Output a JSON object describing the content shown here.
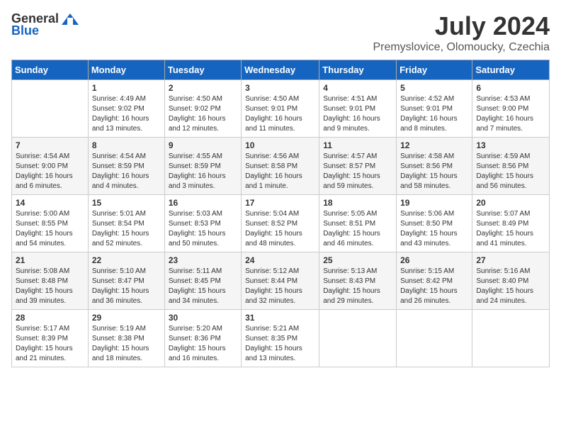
{
  "header": {
    "logo_general": "General",
    "logo_blue": "Blue",
    "title": "July 2024",
    "subtitle": "Premyslovice, Olomoucky, Czechia"
  },
  "days_of_week": [
    "Sunday",
    "Monday",
    "Tuesday",
    "Wednesday",
    "Thursday",
    "Friday",
    "Saturday"
  ],
  "weeks": [
    [
      {
        "day": "",
        "info": ""
      },
      {
        "day": "1",
        "info": "Sunrise: 4:49 AM\nSunset: 9:02 PM\nDaylight: 16 hours\nand 13 minutes."
      },
      {
        "day": "2",
        "info": "Sunrise: 4:50 AM\nSunset: 9:02 PM\nDaylight: 16 hours\nand 12 minutes."
      },
      {
        "day": "3",
        "info": "Sunrise: 4:50 AM\nSunset: 9:01 PM\nDaylight: 16 hours\nand 11 minutes."
      },
      {
        "day": "4",
        "info": "Sunrise: 4:51 AM\nSunset: 9:01 PM\nDaylight: 16 hours\nand 9 minutes."
      },
      {
        "day": "5",
        "info": "Sunrise: 4:52 AM\nSunset: 9:01 PM\nDaylight: 16 hours\nand 8 minutes."
      },
      {
        "day": "6",
        "info": "Sunrise: 4:53 AM\nSunset: 9:00 PM\nDaylight: 16 hours\nand 7 minutes."
      }
    ],
    [
      {
        "day": "7",
        "info": "Sunrise: 4:54 AM\nSunset: 9:00 PM\nDaylight: 16 hours\nand 6 minutes."
      },
      {
        "day": "8",
        "info": "Sunrise: 4:54 AM\nSunset: 8:59 PM\nDaylight: 16 hours\nand 4 minutes."
      },
      {
        "day": "9",
        "info": "Sunrise: 4:55 AM\nSunset: 8:59 PM\nDaylight: 16 hours\nand 3 minutes."
      },
      {
        "day": "10",
        "info": "Sunrise: 4:56 AM\nSunset: 8:58 PM\nDaylight: 16 hours\nand 1 minute."
      },
      {
        "day": "11",
        "info": "Sunrise: 4:57 AM\nSunset: 8:57 PM\nDaylight: 15 hours\nand 59 minutes."
      },
      {
        "day": "12",
        "info": "Sunrise: 4:58 AM\nSunset: 8:56 PM\nDaylight: 15 hours\nand 58 minutes."
      },
      {
        "day": "13",
        "info": "Sunrise: 4:59 AM\nSunset: 8:56 PM\nDaylight: 15 hours\nand 56 minutes."
      }
    ],
    [
      {
        "day": "14",
        "info": "Sunrise: 5:00 AM\nSunset: 8:55 PM\nDaylight: 15 hours\nand 54 minutes."
      },
      {
        "day": "15",
        "info": "Sunrise: 5:01 AM\nSunset: 8:54 PM\nDaylight: 15 hours\nand 52 minutes."
      },
      {
        "day": "16",
        "info": "Sunrise: 5:03 AM\nSunset: 8:53 PM\nDaylight: 15 hours\nand 50 minutes."
      },
      {
        "day": "17",
        "info": "Sunrise: 5:04 AM\nSunset: 8:52 PM\nDaylight: 15 hours\nand 48 minutes."
      },
      {
        "day": "18",
        "info": "Sunrise: 5:05 AM\nSunset: 8:51 PM\nDaylight: 15 hours\nand 46 minutes."
      },
      {
        "day": "19",
        "info": "Sunrise: 5:06 AM\nSunset: 8:50 PM\nDaylight: 15 hours\nand 43 minutes."
      },
      {
        "day": "20",
        "info": "Sunrise: 5:07 AM\nSunset: 8:49 PM\nDaylight: 15 hours\nand 41 minutes."
      }
    ],
    [
      {
        "day": "21",
        "info": "Sunrise: 5:08 AM\nSunset: 8:48 PM\nDaylight: 15 hours\nand 39 minutes."
      },
      {
        "day": "22",
        "info": "Sunrise: 5:10 AM\nSunset: 8:47 PM\nDaylight: 15 hours\nand 36 minutes."
      },
      {
        "day": "23",
        "info": "Sunrise: 5:11 AM\nSunset: 8:45 PM\nDaylight: 15 hours\nand 34 minutes."
      },
      {
        "day": "24",
        "info": "Sunrise: 5:12 AM\nSunset: 8:44 PM\nDaylight: 15 hours\nand 32 minutes."
      },
      {
        "day": "25",
        "info": "Sunrise: 5:13 AM\nSunset: 8:43 PM\nDaylight: 15 hours\nand 29 minutes."
      },
      {
        "day": "26",
        "info": "Sunrise: 5:15 AM\nSunset: 8:42 PM\nDaylight: 15 hours\nand 26 minutes."
      },
      {
        "day": "27",
        "info": "Sunrise: 5:16 AM\nSunset: 8:40 PM\nDaylight: 15 hours\nand 24 minutes."
      }
    ],
    [
      {
        "day": "28",
        "info": "Sunrise: 5:17 AM\nSunset: 8:39 PM\nDaylight: 15 hours\nand 21 minutes."
      },
      {
        "day": "29",
        "info": "Sunrise: 5:19 AM\nSunset: 8:38 PM\nDaylight: 15 hours\nand 18 minutes."
      },
      {
        "day": "30",
        "info": "Sunrise: 5:20 AM\nSunset: 8:36 PM\nDaylight: 15 hours\nand 16 minutes."
      },
      {
        "day": "31",
        "info": "Sunrise: 5:21 AM\nSunset: 8:35 PM\nDaylight: 15 hours\nand 13 minutes."
      },
      {
        "day": "",
        "info": ""
      },
      {
        "day": "",
        "info": ""
      },
      {
        "day": "",
        "info": ""
      }
    ]
  ]
}
